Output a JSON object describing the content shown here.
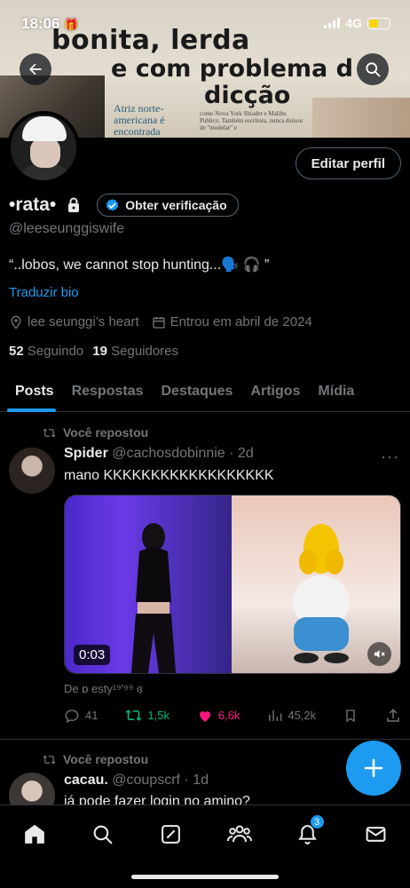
{
  "status": {
    "time": "18:06",
    "network": "4G"
  },
  "banner": {
    "headline1": "bonita, lerda",
    "headline2": "e com problema d",
    "headline3": "dicção",
    "caption": "Atriz norte-americana é encontrada",
    "small_text": "como Nova York Shiader e Malibu Publico. Também escritora, nunca deixou de \"modelar\" e"
  },
  "profile": {
    "name": "•rata•",
    "verify_label": "Obter verificação",
    "edit_label": "Editar perfil",
    "handle": "@leeseunggiswife",
    "bio": "“..lobos, we cannot stop hunting...🗣️ 🎧 ”",
    "translate_label": "Traduzir bio",
    "location": "lee seunggi’s heart",
    "joined": "Entrou em abril de 2024",
    "following_count": "52",
    "following_label": "Seguindo",
    "followers_count": "19",
    "followers_label": "Seguidores"
  },
  "tabs": [
    {
      "label": "Posts"
    },
    {
      "label": "Respostas"
    },
    {
      "label": "Destaques"
    },
    {
      "label": "Artigos"
    },
    {
      "label": "Mídia"
    }
  ],
  "posts": [
    {
      "repost_label": "Você repostou",
      "author": "Spider",
      "handle": "@cachosdobinnie",
      "time": "· 2d",
      "text": "mano KKKKKKKKKKKKKKKKKK",
      "duration": "0:03",
      "credit": "De ɒ esty¹⁹'⁹⁹ ɞ",
      "replies": "41",
      "reposts": "1,5k",
      "likes": "6,6k",
      "views": "45,2k"
    },
    {
      "repost_label": "Você repostou",
      "author": "cacau.",
      "handle": "@coupscrf",
      "time": "· 1d",
      "text": "já pode fazer login no amino?"
    }
  ],
  "nav": {
    "notifications_badge": "3"
  },
  "colors": {
    "accent": "#1d9bf0",
    "repost": "#00ba7c",
    "like": "#f91880",
    "muted": "#71767b"
  }
}
